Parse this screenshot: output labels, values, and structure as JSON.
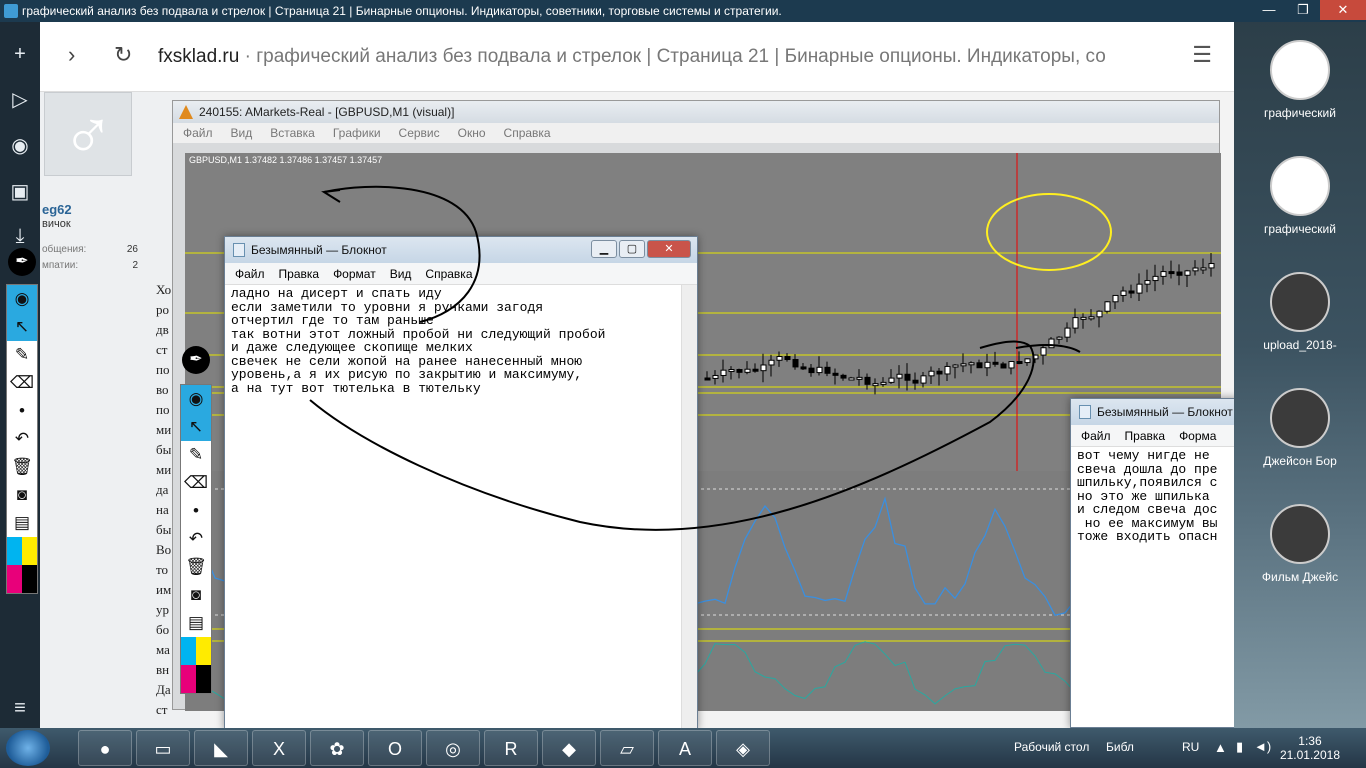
{
  "window": {
    "title": "графический анализ без подвала и стрелок | Страница 21 | Бинарные опционы. Индикаторы, советники, торговые системы и стратегии.",
    "minimize": "—",
    "restore": "❐",
    "close": "✕"
  },
  "left_toolbar": {
    "items": [
      {
        "name": "add-icon",
        "glyph": "+"
      },
      {
        "name": "play-icon",
        "glyph": "▷"
      },
      {
        "name": "camera-icon",
        "glyph": "◉"
      },
      {
        "name": "image-icon",
        "glyph": "▣"
      },
      {
        "name": "download-icon",
        "glyph": "⤓"
      },
      {
        "name": "menu-icon",
        "glyph": "≡"
      }
    ]
  },
  "address_bar": {
    "back": "›",
    "reload": "↻",
    "domain": "fxsklad.ru",
    "rest": " · графический анализ без подвала и стрелок | Страница 21 | Бинарные опционы. Индикаторы, со",
    "menu": "☰"
  },
  "forum": {
    "username": "eg62",
    "rank": "вичок",
    "stats": [
      {
        "label": "общения:",
        "value": "26"
      },
      {
        "label": "мпатии:",
        "value": "2"
      }
    ],
    "post_chars": [
      "Хо",
      "ро",
      "дв",
      "ст",
      "по",
      "во",
      "по",
      "ми",
      "бы",
      "ми",
      "да",
      "на",
      "бы",
      "Во",
      "то",
      "им",
      "ур",
      "бо",
      "ма",
      "вн",
      "Да",
      "ст"
    ]
  },
  "metatrader": {
    "title": "240155: AMarkets-Real - [GBPUSD,M1 (visual)]",
    "menu": [
      "Файл",
      "Вид",
      "Вставка",
      "Графики",
      "Сервис",
      "Окно",
      "Справка"
    ],
    "symbol_line": "GBPUSD,M1  1.37482 1.37486 1.37457 1.37457"
  },
  "notepad_main": {
    "title": "Безымянный — Блокнот",
    "menu": [
      "Файл",
      "Правка",
      "Формат",
      "Вид",
      "Справка"
    ],
    "text": "ладно на дисерт и спать иду\nесли заметили то уровни я ручками загодя\nотчертил где то там раньше\nтак вотни этот ложный пробой ни следующий пробой\nи даже следующее скопище мелких\nсвечек не сели жопой на ранее нанесенный мною\nуровень,а я их рисую по закрытию и максимуму,\nа на тут вот тютелька в тютельку"
  },
  "notepad_second": {
    "title": "Безымянный — Блокнот",
    "menu": [
      "Файл",
      "Правка",
      "Форма"
    ],
    "text": "вот чему нигде не\nсвеча дошла до пре\nшпильку,появился с\nно это же шпилька\nи следом свеча дос\n но ее максимум вы\nтоже входить опасн"
  },
  "annotation_toolbar": {
    "items": [
      {
        "name": "eye-icon",
        "glyph": "◉",
        "selected": true
      },
      {
        "name": "pointer-icon",
        "glyph": "↖",
        "selected": true
      },
      {
        "name": "pen-icon",
        "glyph": "✎",
        "selected": false
      },
      {
        "name": "eraser-icon",
        "glyph": "⌫",
        "selected": false
      },
      {
        "name": "dot-icon",
        "glyph": "•",
        "selected": false
      },
      {
        "name": "undo-icon",
        "glyph": "↶",
        "selected": false
      },
      {
        "name": "trash-icon",
        "glyph": "🗑",
        "selected": false
      },
      {
        "name": "screenshot-icon",
        "glyph": "◙",
        "selected": false
      },
      {
        "name": "clipboard-icon",
        "glyph": "▤",
        "selected": false
      }
    ],
    "palette": [
      "#00b4f0",
      "#ffeb00",
      "#e8007a",
      "#000000"
    ]
  },
  "right_panel": {
    "items": [
      {
        "label": "графический",
        "style": "light"
      },
      {
        "label": "графический",
        "style": "light"
      },
      {
        "label": "upload_2018-",
        "style": "dark"
      },
      {
        "label": "Джейсон Бор",
        "style": "dark"
      },
      {
        "label": "Фильм Джейс",
        "style": "dark"
      }
    ]
  },
  "taskbar": {
    "apps": [
      {
        "name": "chrome-icon",
        "glyph": "●"
      },
      {
        "name": "file-explorer-icon",
        "glyph": "▭"
      },
      {
        "name": "visual-studio-icon",
        "glyph": "◣"
      },
      {
        "name": "excel-icon",
        "glyph": "X"
      },
      {
        "name": "flower-app-icon",
        "glyph": "✿"
      },
      {
        "name": "opera-icon",
        "glyph": "O"
      },
      {
        "name": "opera-neon-icon",
        "glyph": "◎"
      },
      {
        "name": "terminal-app-icon",
        "glyph": "R"
      },
      {
        "name": "pen-app-icon",
        "glyph": "◆"
      },
      {
        "name": "notepad-app-icon",
        "glyph": "▱"
      },
      {
        "name": "amarkets-icon",
        "glyph": "A"
      },
      {
        "name": "metatrader-icon",
        "glyph": "◈"
      }
    ],
    "desktop_label": "Рабочий стол",
    "folder_label": "Библ",
    "language": "RU",
    "time": "1:36",
    "date": "21.01.2018"
  }
}
